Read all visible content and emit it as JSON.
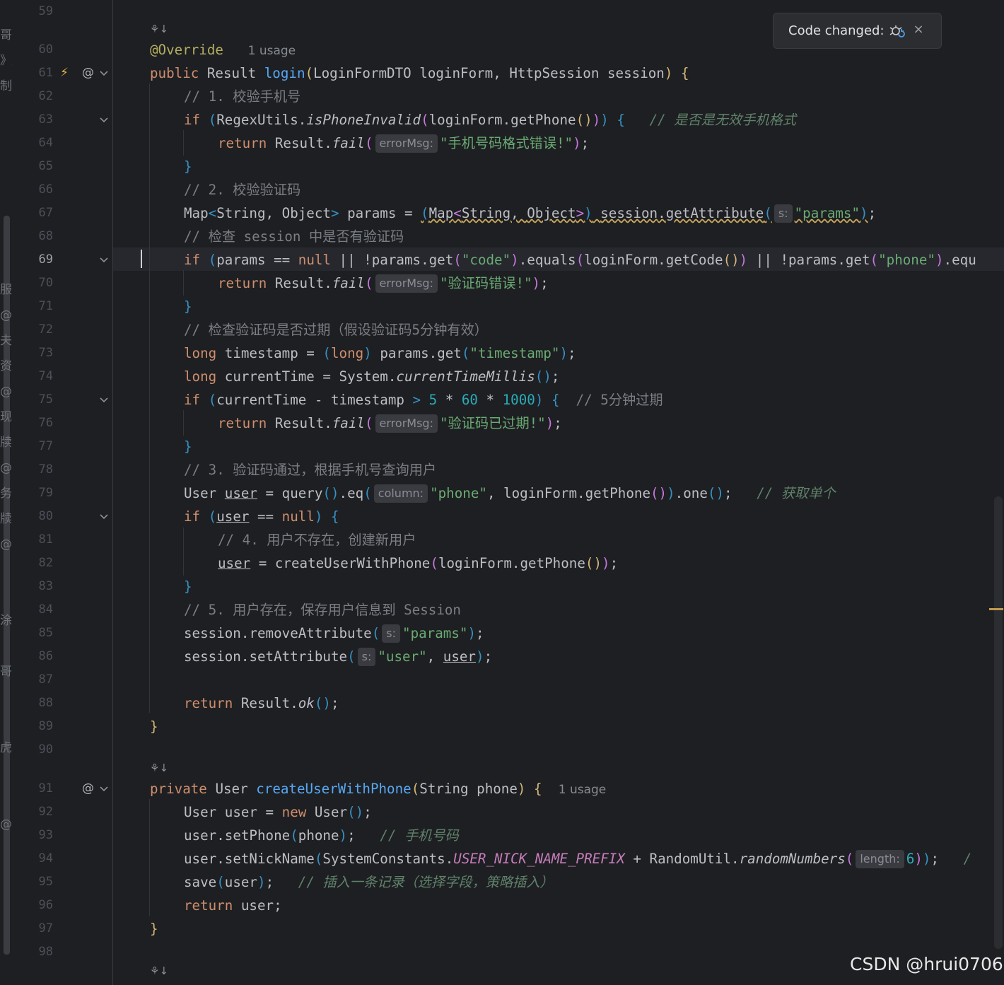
{
  "notification": {
    "text": "Code changed:",
    "icon": "reload-debug-icon",
    "close": "×"
  },
  "watermark": "CSDN @hrui0706",
  "left_strip": [
    "哥",
    "》厉",
    "制",
    "服务",
    "@",
    "夫(",
    "资杀",
    "@",
    "现",
    "牍类",
    "@",
    "务",
    "牍类",
    "@",
    "涂",
    "哥",
    "虎",
    "@"
  ],
  "gutter": {
    "line_numbers": [
      "59",
      "60",
      "61",
      "62",
      "63",
      "64",
      "65",
      "66",
      "67",
      "68",
      "69",
      "70",
      "71",
      "72",
      "73",
      "74",
      "75",
      "76",
      "77",
      "78",
      "79",
      "80",
      "81",
      "82",
      "83",
      "84",
      "85",
      "86",
      "87",
      "88",
      "89",
      "90",
      "91",
      "92",
      "93",
      "94",
      "95",
      "96",
      "97",
      "98"
    ],
    "current_line": "69",
    "icons": {
      "at_sign": "@",
      "override_icon": "method-override-icon",
      "fold": "chevron-down-icon"
    }
  },
  "code": {
    "inlay": {
      "usages": "1 usage",
      "errorMsg": "errorMsg:",
      "s": "s:",
      "column": "column:",
      "length": "length:"
    },
    "t": {
      "Override": "@Override",
      "kw_public": "public",
      "kw_private": "private",
      "kw_if": "if",
      "kw_return": "return",
      "kw_null": "null",
      "kw_long": "long",
      "kw_new": "new",
      "Result": "Result",
      "login": "login",
      "LoginFormDTO": "LoginFormDTO",
      "loginForm": "loginForm",
      "HttpSession": "HttpSession",
      "session": "session",
      "RegexUtils": "RegexUtils",
      "isPhoneInvalid": "isPhoneInvalid",
      "getPhone": "getPhone",
      "fail": "fail",
      "ok": "ok",
      "Map": "Map",
      "String": "String",
      "Object": "Object",
      "params": "params",
      "getAttribute": "getAttribute",
      "get": "get",
      "equals": "equals",
      "getCode": "getCode",
      "equ": "equ",
      "timestamp": "timestamp",
      "currentTime": "currentTime",
      "System": "System",
      "currentTimeMillis": "currentTimeMillis",
      "User": "User",
      "user": "user",
      "query": "query",
      "eq": "eq",
      "one": "one",
      "createUserWithPhone": "createUserWithPhone",
      "removeAttribute": "removeAttribute",
      "setAttribute": "setAttribute",
      "phone": "phone",
      "setPhone": "setPhone",
      "setNickName": "setNickName",
      "SystemConstants": "SystemConstants",
      "USER_NICK_NAME_PREFIX": "USER_NICK_NAME_PREFIX",
      "RandomUtil": "RandomUtil",
      "randomNumbers": "randomNumbers",
      "save": "save",
      "slash": "/",
      "n5": "5",
      "n60": "60",
      "n1000": "1000",
      "n6": "6"
    },
    "strings": {
      "phone_err": "\"手机号码格式错误!\"",
      "params": "\"params\"",
      "code": "\"code\"",
      "phone": "\"phone\"",
      "code_err": "\"验证码错误!\"",
      "timestamp": "\"timestamp\"",
      "expired": "\"验证码已过期!\"",
      "user": "\"user\""
    },
    "comments": {
      "c62": "// 1. 校验手机号",
      "c63": "// 是否是无效手机格式",
      "c66": "// 2. 校验验证码",
      "c68": "// 检查 session 中是否有验证码",
      "c72": "// 检查验证码是否过期（假设验证码5分钟有效）",
      "c75": "// 5分钟过期",
      "c78": "// 3. 验证码通过，根据手机号查询用户",
      "c79": "// 获取单个",
      "c81": "// 4. 用户不存在，创建新用户",
      "c84": "// 5. 用户存在，保存用户信息到 Session",
      "c93": "// 手机号码",
      "c95": "// 插入一条记录（选择字段，策略插入）"
    }
  }
}
